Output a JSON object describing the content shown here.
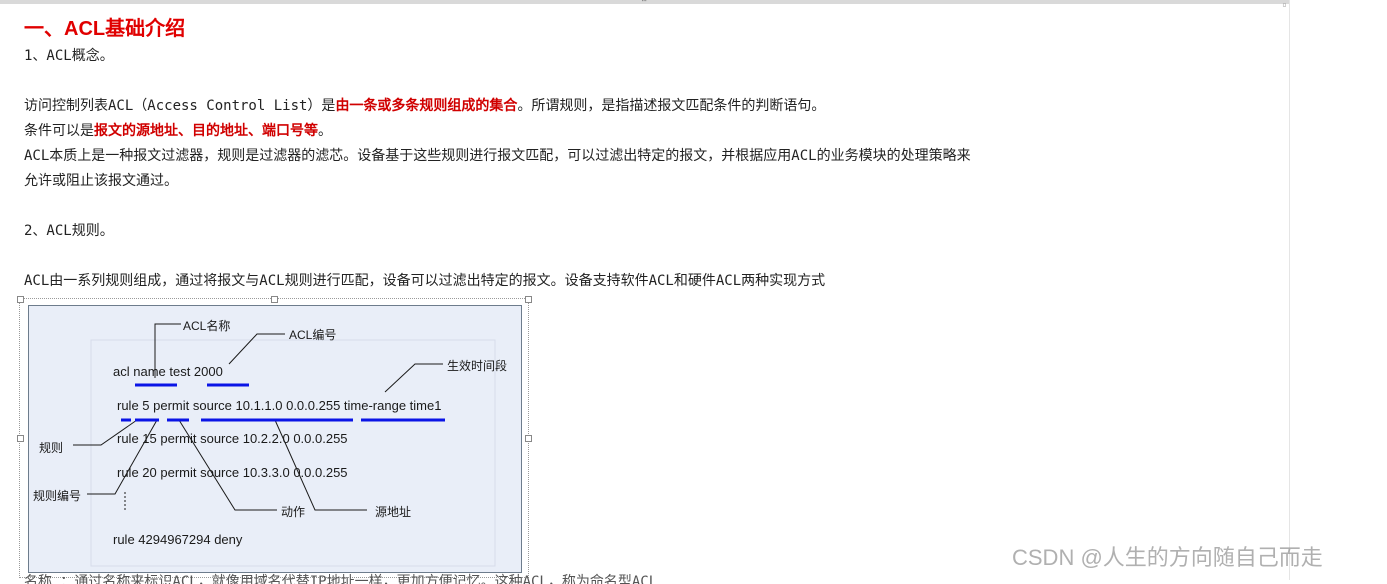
{
  "heading": "一、ACL基础介绍",
  "section1": "1、ACL概念。",
  "para1": {
    "before": "访问控制列表ACL（Access Control List）是",
    "highlight": "由一条或多条规则组成的集合",
    "after": "。所谓规则，是指描述报文匹配条件的判断语句。"
  },
  "para2": {
    "before": "条件可以是",
    "highlight": "报文的源地址、目的地址、端口号等",
    "after": "。"
  },
  "para3_line1": "ACL本质上是一种报文过滤器，规则是过滤器的滤芯。设备基于这些规则进行报文匹配，可以过滤出特定的报文，并根据应用ACL的业务模块的处理策略来",
  "para3_line2": "允许或阻止该报文通过。",
  "section2": "2、ACL规则。",
  "para4": "ACL由一系列规则组成，通过将报文与ACL规则进行匹配，设备可以过滤出特定的报文。设备支持软件ACL和硬件ACL两种实现方式",
  "figure": {
    "label_acl_name": "ACL名称",
    "label_acl_number": "ACL编号",
    "label_time": "生效时间段",
    "label_rule": "规则",
    "label_rule_number": "规则编号",
    "label_action": "动作",
    "label_source": "源地址",
    "line1": "acl name test 2000",
    "line2": "rule 5 permit source 10.1.1.0 0.0.0.255 time-range time1",
    "line3": "rule 15 permit source 10.2.2.0 0.0.0.255",
    "line4": "rule 20 permit source 10.3.3.0 0.0.0.255",
    "line5": "rule 4294967294 deny",
    "underline_color": "#0a14e6"
  },
  "watermark": "CSDN @人生的方向随自己而走",
  "cut_text": "名称 ：通过名称来标识ACL，就像用域名代替IP地址一样，更加方便记忆。这种ACL，称为命名型ACL"
}
